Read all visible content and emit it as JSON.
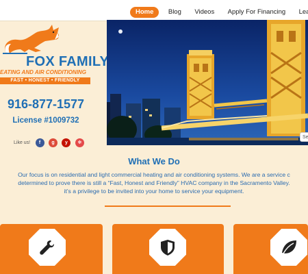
{
  "nav": {
    "items": [
      "Home",
      "Blog",
      "Videos",
      "Apply For Financing",
      "Leav"
    ],
    "active_index": 0
  },
  "brand": {
    "name": "FOX FAMILY",
    "subtitle": "EATING AND AIR CONDITIONING",
    "tagline": "FAST  •  HONEST  •  FRIENDLY"
  },
  "contact": {
    "phone": "916-877-1577",
    "license": "License #1009732",
    "like_us": "Like us!"
  },
  "social_icons": [
    "facebook-icon",
    "google-plus-icon",
    "yelp-icon",
    "share-icon"
  ],
  "hero": {
    "search_fragment": "Se"
  },
  "what_we_do": {
    "title": "What We Do",
    "lines": [
      "Our focus is on residential and light commercial heating and air conditioning systems. We are a service c",
      "determined to prove there is still a “Fast, Honest and Friendly” HVAC company in the Sacramento Valley.",
      "it’s a privilege to be invited into your home to service your equipment."
    ]
  },
  "cards": [
    {
      "icon": "wrench-icon"
    },
    {
      "icon": "shield-icon"
    },
    {
      "icon": "leaf-icon"
    }
  ],
  "colors": {
    "accent": "#f07a1a",
    "brand_blue": "#1f6fb5",
    "background": "#fbeed6"
  }
}
